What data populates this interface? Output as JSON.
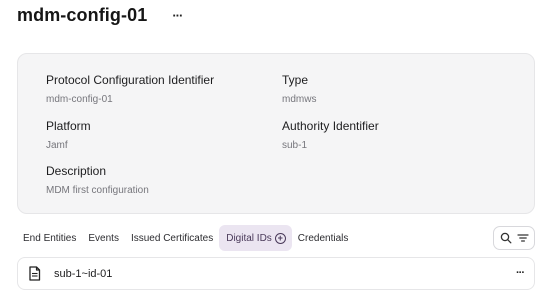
{
  "header": {
    "title": "mdm-config-01",
    "more_label": "···"
  },
  "details": {
    "protocol_config_id": {
      "label": "Protocol Configuration Identifier",
      "value": "mdm-config-01"
    },
    "type": {
      "label": "Type",
      "value": "mdmws"
    },
    "platform": {
      "label": "Platform",
      "value": "Jamf"
    },
    "authority_id": {
      "label": "Authority Identifier",
      "value": "sub-1"
    },
    "description": {
      "label": "Description",
      "value": "MDM first configuration"
    }
  },
  "tabs": [
    {
      "label": "End Entities",
      "active": false
    },
    {
      "label": "Events",
      "active": false
    },
    {
      "label": "Issued Certificates",
      "active": false
    },
    {
      "label": "Digital IDs",
      "active": true,
      "icon": "plus-circle-icon"
    },
    {
      "label": "Credentials",
      "active": false
    }
  ],
  "toolbar": {
    "search_icon": "search-icon",
    "filter_icon": "filter-icon"
  },
  "list": {
    "items": [
      {
        "label": "sub-1~id-01",
        "icon": "document-icon",
        "more_label": "···"
      }
    ]
  },
  "colors": {
    "active_tab_bg": "#ebe5f1",
    "card_bg": "#f5f5f6",
    "muted_text": "#76767c"
  }
}
